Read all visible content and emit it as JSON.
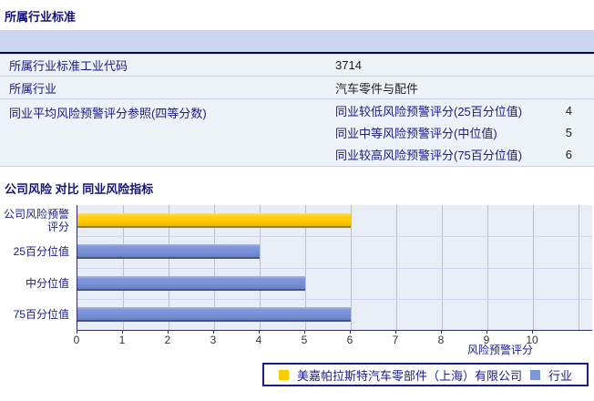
{
  "sections": {
    "industry_standard": {
      "title": "所属行业标准"
    },
    "comparison": {
      "title": "公司风险 对比 同业风险指标"
    }
  },
  "table": {
    "rows": [
      {
        "label": "所属行业标准工业代码",
        "value": "3714"
      },
      {
        "label": "所属行业",
        "value": "汽车零件与配件"
      },
      {
        "label": "同业平均风险预警评分参照(四等分数)",
        "subrows": [
          {
            "label": "同业较低风险预警评分(25百分位值)",
            "value": "4"
          },
          {
            "label": "同业中等风险预警评分(中位值)",
            "value": "5"
          },
          {
            "label": "同业较高风险预警评分(75百分位值)",
            "value": "6"
          }
        ]
      }
    ]
  },
  "chart_data": {
    "type": "bar",
    "orientation": "horizontal",
    "categories": [
      "公司风险预警评分",
      "25百分位值",
      "中分位值",
      "75百分位值"
    ],
    "bars": [
      {
        "category": "公司风险预警评分",
        "value": 6,
        "series": "company"
      },
      {
        "category": "25百分位值",
        "value": 4,
        "series": "industry"
      },
      {
        "category": "中分位值",
        "value": 5,
        "series": "industry"
      },
      {
        "category": "75百分位值",
        "value": 6,
        "series": "industry"
      }
    ],
    "xlabel": "风险预警评分",
    "xlim": [
      0,
      10
    ],
    "xticks": [
      0,
      1,
      2,
      3,
      4,
      5,
      6,
      7,
      8,
      9,
      10
    ],
    "grid": true,
    "legend_position": "bottom",
    "legend": [
      {
        "label": "美嘉帕拉斯特汽车零部件（上海）有限公司",
        "series": "company",
        "color": "#ffca00"
      },
      {
        "label": "行业",
        "series": "industry",
        "color": "#7b96d9"
      }
    ]
  }
}
